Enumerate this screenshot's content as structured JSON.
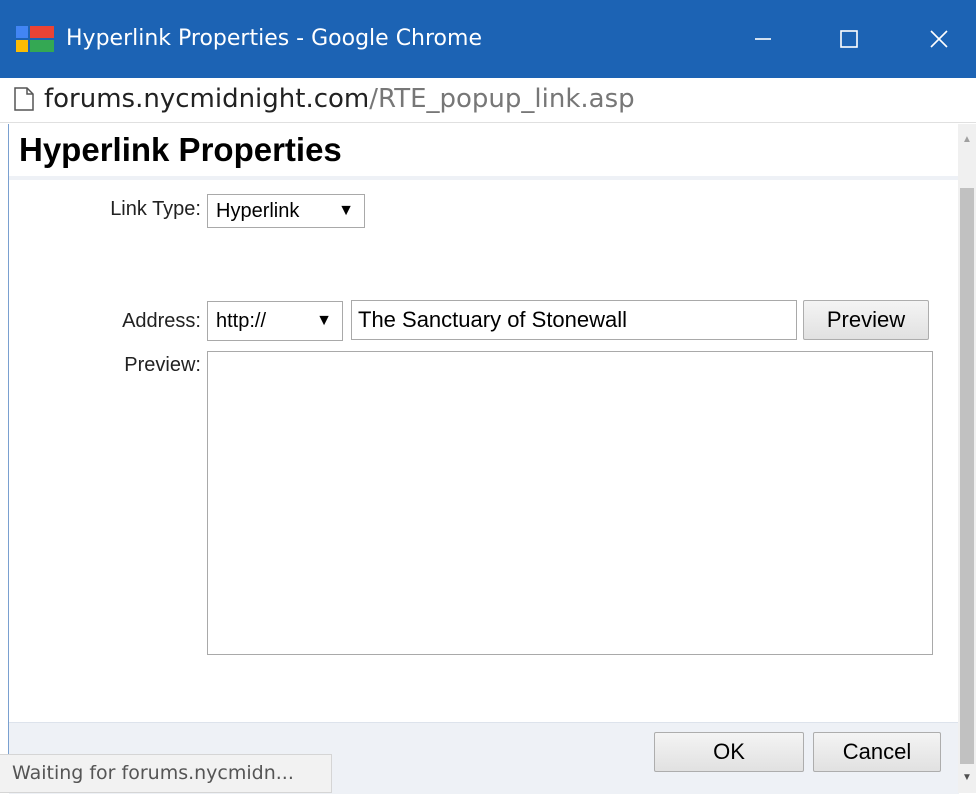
{
  "window": {
    "title": "Hyperlink Properties - Google Chrome",
    "controls": {
      "minimize_icon": "minimize-icon",
      "maximize_icon": "maximize-icon",
      "close_icon": "close-icon"
    },
    "accent": "#1c63b4"
  },
  "address_bar": {
    "domain": "forums.nycmidnight.com",
    "path": "/RTE_popup_link.asp"
  },
  "dialog": {
    "heading": "Hyperlink Properties",
    "link_type": {
      "label": "Link Type:",
      "value": "Hyperlink",
      "arrow": "▼"
    },
    "address": {
      "label": "Address:",
      "protocol": "http://",
      "protocol_arrow": "▼",
      "value": "The Sanctuary of Stonewall",
      "preview_button": "Preview"
    },
    "preview": {
      "label": "Preview:"
    },
    "buttons": {
      "ok": "OK",
      "cancel": "Cancel"
    }
  },
  "status": {
    "text": "Waiting for forums.nycmidn..."
  }
}
